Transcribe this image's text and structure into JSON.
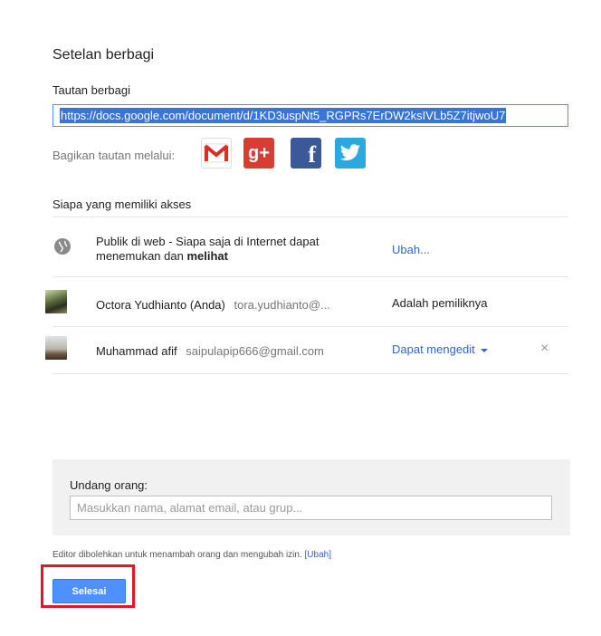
{
  "dialog": {
    "title": "Setelan berbagi"
  },
  "share_link": {
    "label": "Tautan berbagi",
    "url": "https://docs.google.com/document/d/1KD3uspNt5_RGPRs7ErDW2ksIVLb5Z7itjwoU7"
  },
  "share_via": {
    "label": "Bagikan tautan melalui:",
    "icons": [
      "gmail-icon",
      "google-plus-icon",
      "facebook-icon",
      "twitter-icon"
    ],
    "gplus_glyph": "g+",
    "facebook_glyph": "f"
  },
  "access": {
    "title": "Siapa yang memiliki akses",
    "public": {
      "text_prefix": "Publik di web - Siapa saja di Internet dapat menemukan dan ",
      "text_bold": "melihat",
      "action": "Ubah..."
    },
    "users": [
      {
        "name": "Octora Yudhianto (Anda)",
        "email": "tora.yudhianto@...",
        "role": "Adalah pemiliknya"
      },
      {
        "name": "Muhammad afif",
        "email": "saipulapip666@gmail.com",
        "role": "Dapat mengedit",
        "remove": "×"
      }
    ]
  },
  "invite": {
    "label": "Undang orang:",
    "placeholder": "Masukkan nama, alamat email, atau grup..."
  },
  "editor_note": {
    "text": "Editor dibolehkan untuk menambah orang dan mengubah izin.",
    "link": "[Ubah]"
  },
  "done_button": {
    "label": "Selesai"
  },
  "colors": {
    "accent_blue": "#4d90fe",
    "link_blue": "#3366cc",
    "highlight_red": "#e8132b"
  }
}
